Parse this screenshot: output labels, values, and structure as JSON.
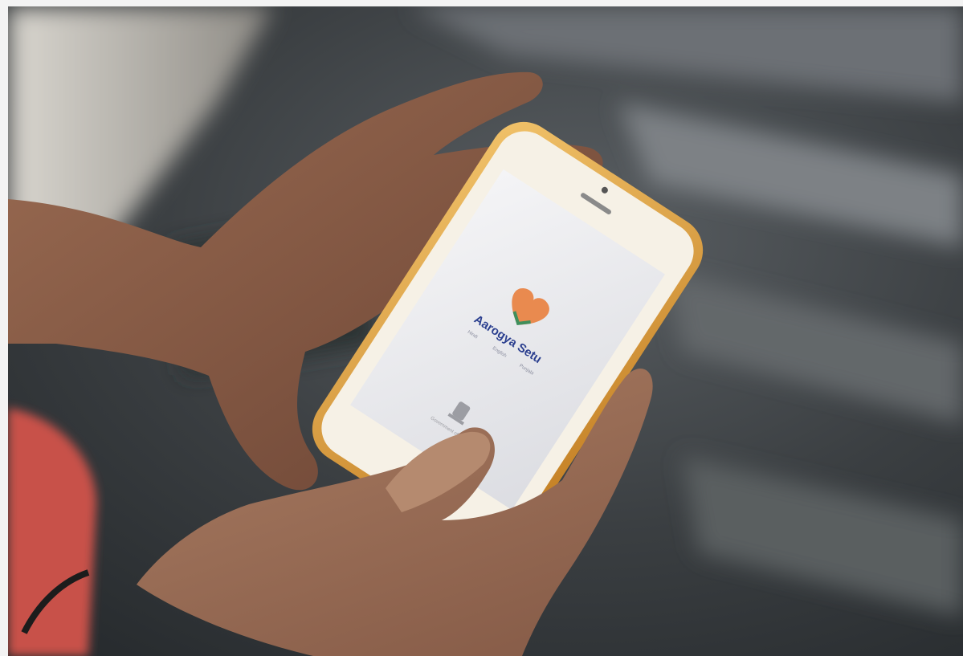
{
  "app_screen": {
    "app_name": "Aarogya Setu",
    "tagline_words": [
      "Hindi",
      "English",
      "Punjabi"
    ],
    "footer_text": "Government of India"
  },
  "colors": {
    "heart_orange": "#e98a4f",
    "heart_green": "#3f8f5c",
    "app_name_blue": "#2b3f8f",
    "phone_gold": "#d6952c",
    "screen_white": "#eeeef0"
  },
  "icons": {
    "app_logo": "heart-icon",
    "emblem": "emblem-icon"
  }
}
